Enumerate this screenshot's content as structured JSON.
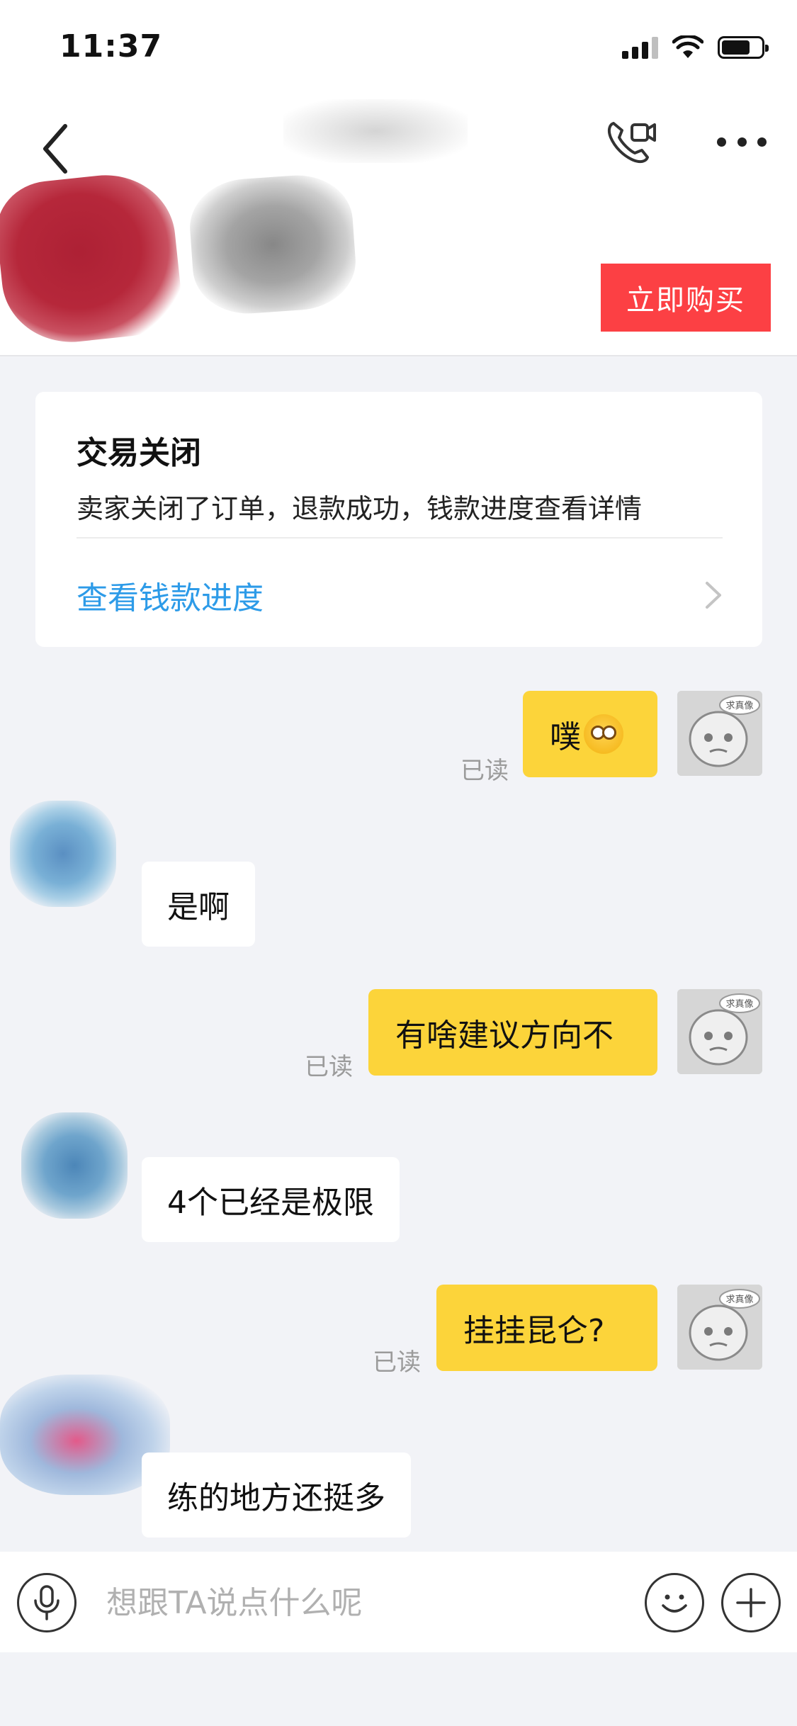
{
  "status_bar": {
    "time": "11:37"
  },
  "header": {
    "buy_label": "立即购买",
    "icons": {
      "back": "chevron-left-icon",
      "call": "video-phone-icon",
      "more": "more-dots-icon"
    }
  },
  "order": {
    "title": "交易关闭",
    "description": "卖家关闭了订单，退款成功，钱款进度查看详情",
    "link_label": "查看钱款进度"
  },
  "messages": [
    {
      "from": "me",
      "text": "噗",
      "emoji": "astonished-face",
      "read": "已读"
    },
    {
      "from": "other",
      "text": "是啊"
    },
    {
      "from": "me",
      "text": "有啥建议方向不",
      "read": "已读"
    },
    {
      "from": "other",
      "text": "4个已经是极限"
    },
    {
      "from": "me",
      "text": "挂挂昆仑?",
      "read": "已读"
    },
    {
      "from": "other",
      "text": "练的地方还挺多"
    }
  ],
  "my_avatar_tag": "求真像",
  "input": {
    "placeholder": "想跟TA说点什么呢",
    "icons": {
      "voice": "microphone-icon",
      "emoji": "smiley-icon",
      "more": "plus-icon"
    }
  },
  "colors": {
    "accent_buy": "#fc4044",
    "bubble_me": "#fcd43a",
    "link_blue": "#2d9be8",
    "background": "#f2f3f7"
  }
}
